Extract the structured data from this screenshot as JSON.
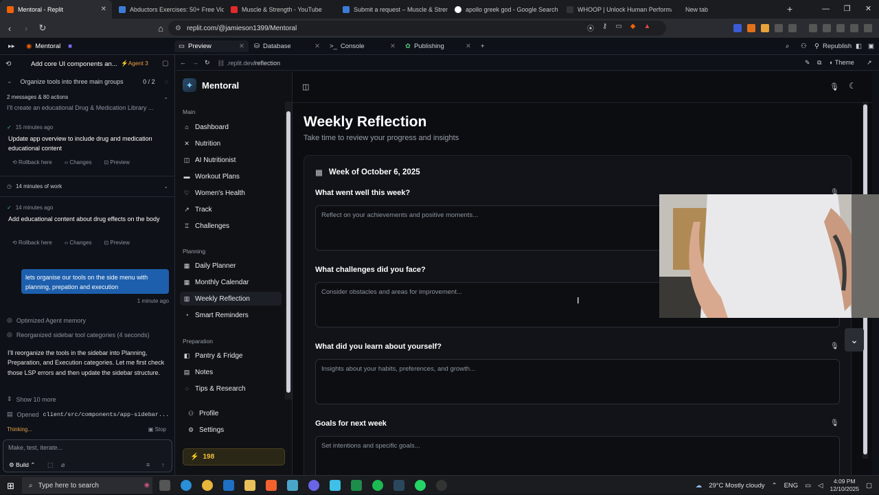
{
  "browser": {
    "tabs": [
      {
        "title": "Mentoral - Replit",
        "color": "#f26207"
      },
      {
        "title": "Abductors Exercises: 50+ Free Videos",
        "color": "#3d7bd9"
      },
      {
        "title": "Muscle & Strength - YouTube",
        "color": "#e32a2a"
      },
      {
        "title": "Submit a request – Muscle & Strength",
        "color": "#3d7bd9"
      },
      {
        "title": "apollo greek god - Google Search",
        "color": "#ffffff"
      },
      {
        "title": "WHOOP | Unlock Human Performance",
        "color": "#222222"
      },
      {
        "title": "New tab",
        "color": "#1b1c1f"
      }
    ],
    "url": "replit.com/@jamieson1399/Mentoral"
  },
  "replit": {
    "project_name": "Mentoral",
    "tabs": [
      "Preview",
      "Database",
      "Console",
      "Publishing"
    ],
    "preview_url_host": ".replit.dev",
    "preview_url_path": "/reflection",
    "republish_label": "Republish",
    "theme_label": "Theme"
  },
  "agent": {
    "thread_title": "Add core UI components an...",
    "agent_badge": "Agent 3",
    "checkpoint": "Organize tools into three main groups",
    "checkpoint_progress": "0 / 2",
    "messages_summary": "2 messages & 80 actions",
    "preview_text": "I'll create an educational Drug & Medication Library ...",
    "entries": [
      {
        "time": "15 minutes ago",
        "title": "Update app overview to include drug and medication educational content"
      },
      {
        "time": "14 minutes ago",
        "title": "Add educational content about drug effects on the body"
      }
    ],
    "work_summary": "14 minutes of work",
    "actions": [
      "Rollback here",
      "Changes",
      "Preview"
    ],
    "user_message": "lets organise our tools on the side menu with planning, prepation and execution",
    "user_message_time": "1 minute ago",
    "status_1": "Optimized Agent memory",
    "status_2": "Reorganized sidebar tool categories (4 seconds)",
    "reply": "I'll reorganize the tools in the sidebar into Planning, Preparation, and Execution categories. Let me first check those LSP errors and then update the sidebar structure.",
    "show_more": "Show 10 more",
    "opened_label": "Opened",
    "opened_file": "client/src/components/app-sidebar...",
    "thinking": "Thinking...",
    "stop_label": "Stop",
    "input_placeholder": "Make, test, iterate...",
    "build_label": "Build"
  },
  "app": {
    "name": "Mentoral",
    "sections": {
      "main": "Main",
      "planning": "Planning",
      "preparation": "Preparation"
    },
    "main_items": [
      "Dashboard",
      "Nutrition",
      "AI Nutritionist",
      "Workout Plans",
      "Women's Health",
      "Track",
      "Challenges"
    ],
    "planning_items": [
      "Daily Planner",
      "Monthly Calendar",
      "Weekly Reflection",
      "Smart Reminders"
    ],
    "preparation_items": [
      "Pantry & Fridge",
      "Notes",
      "Tips & Research"
    ],
    "footer_items": [
      "Profile",
      "Settings"
    ],
    "points": "198"
  },
  "page": {
    "title": "Weekly Reflection",
    "subtitle": "Take time to review your progress and insights",
    "week_label": "Week of October 6, 2025",
    "questions": [
      {
        "label": "What went well this week?",
        "placeholder": "Reflect on your achievements and positive moments..."
      },
      {
        "label": "What challenges did you face?",
        "placeholder": "Consider obstacles and areas for improvement..."
      },
      {
        "label": "What did you learn about yourself?",
        "placeholder": "Insights about your habits, preferences, and growth..."
      },
      {
        "label": "Goals for next week",
        "placeholder": "Set intentions and specific goals..."
      }
    ]
  },
  "taskbar": {
    "search_placeholder": "Type here to search",
    "weather": "29°C  Mostly cloudy",
    "language": "ENG",
    "time": "4:09 PM",
    "date": "12/10/2025"
  }
}
